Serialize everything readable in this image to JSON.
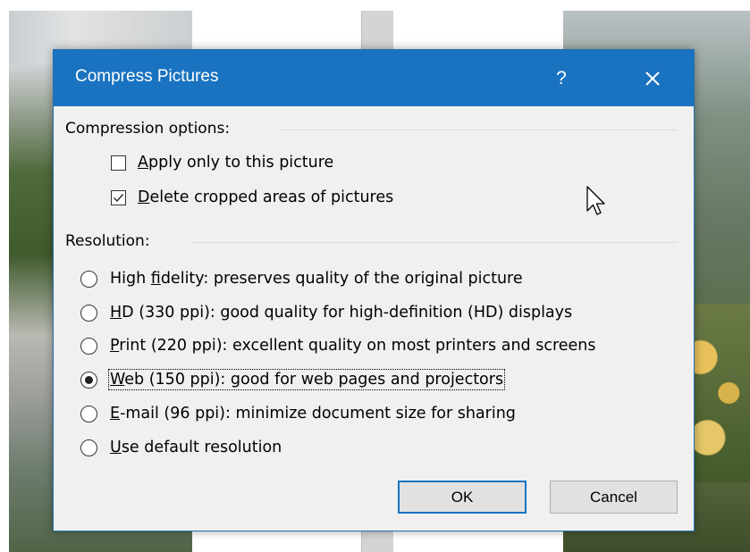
{
  "dialog": {
    "title": "Compress Pictures",
    "help_label": "?",
    "close_icon": "close-icon"
  },
  "compression": {
    "heading": "Compression options:",
    "options": [
      {
        "accesskey": "A",
        "rest": "pply only to this picture",
        "checked": false
      },
      {
        "accesskey": "D",
        "rest": "elete cropped areas of pictures",
        "checked": true
      }
    ]
  },
  "resolution": {
    "heading": "Resolution:",
    "options": [
      {
        "pre": "High ",
        "accesskey": "f",
        "rest": "idelity: preserves quality of the original picture",
        "selected": false
      },
      {
        "pre": "",
        "accesskey": "H",
        "rest": "D (330 ppi): good quality for high-definition (HD) displays",
        "selected": false
      },
      {
        "pre": "",
        "accesskey": "P",
        "rest": "rint (220 ppi): excellent quality on most printers and screens",
        "selected": false
      },
      {
        "pre": "",
        "accesskey": "W",
        "rest": "eb (150 ppi): good for web pages and projectors",
        "selected": true
      },
      {
        "pre": "",
        "accesskey": "E",
        "rest": "-mail (96 ppi): minimize document size for sharing",
        "selected": false
      },
      {
        "pre": "",
        "accesskey": "U",
        "rest": "se default resolution",
        "selected": false
      }
    ]
  },
  "buttons": {
    "ok": "OK",
    "cancel": "Cancel"
  },
  "colors": {
    "titlebar": "#1a73c0",
    "dialog_bg": "#f0f0f0"
  }
}
